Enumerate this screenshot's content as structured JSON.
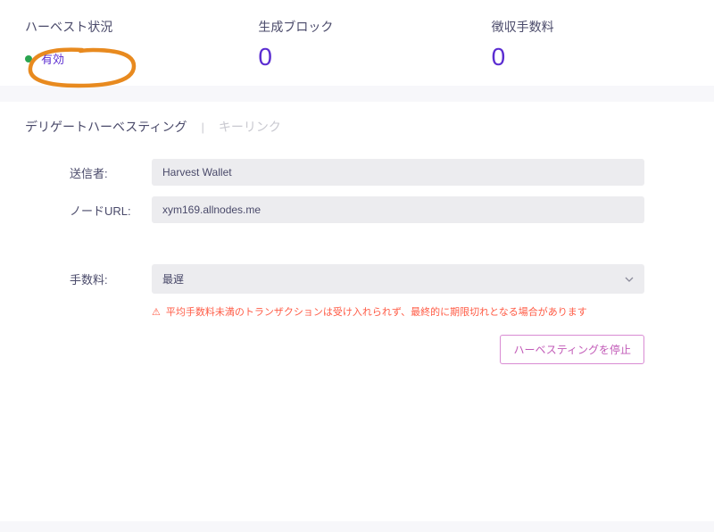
{
  "stats": {
    "harvest_status_label": "ハーベスト状況",
    "status_text": "有効",
    "blocks_label": "生成ブロック",
    "blocks_value": "0",
    "fees_label": "徴収手数料",
    "fees_value": "0"
  },
  "tabs": {
    "delegated": "デリゲートハーベスティング",
    "keylink": "キーリンク",
    "separator": "|"
  },
  "form": {
    "sender_label": "送信者:",
    "sender_value": "Harvest Wallet",
    "node_url_label": "ノードURL:",
    "node_url_value": "xym169.allnodes.me",
    "fee_label": "手数料:",
    "fee_value": "最遅",
    "warning_text": "平均手数料未満のトランザクションは受け入れられず、最終的に期限切れとなる場合があります"
  },
  "actions": {
    "stop_button": "ハーベスティングを停止"
  }
}
